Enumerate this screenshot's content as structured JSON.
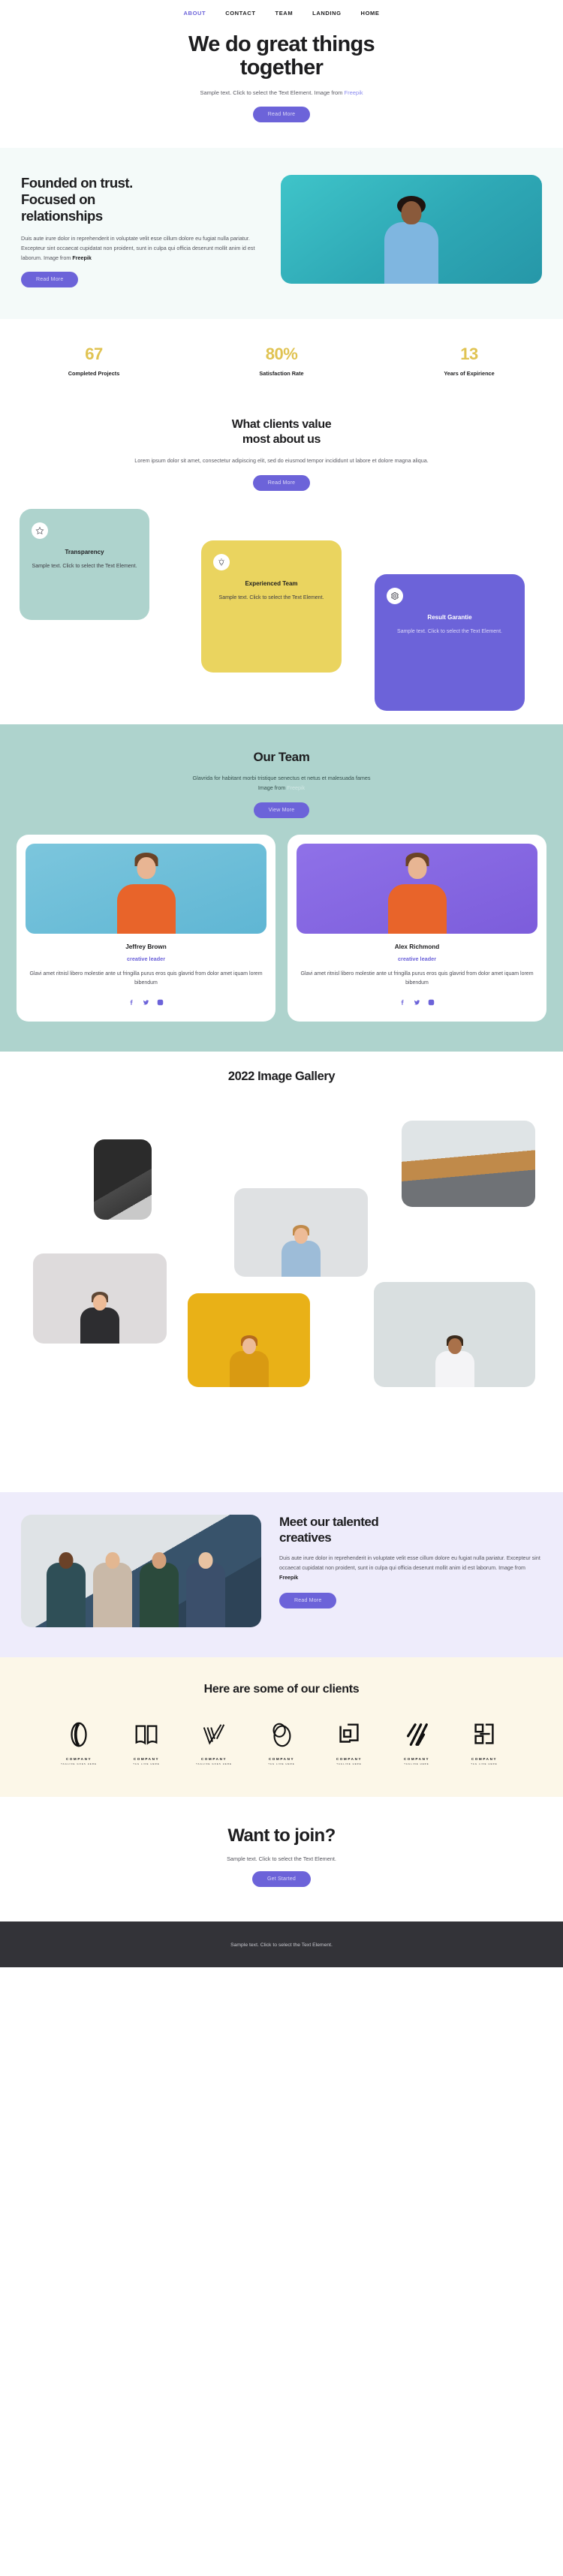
{
  "nav": {
    "items": [
      {
        "label": "ABOUT",
        "active": true
      },
      {
        "label": "CONTACT",
        "active": false
      },
      {
        "label": "TEAM",
        "active": false
      },
      {
        "label": "LANDING",
        "active": false
      },
      {
        "label": "HOME",
        "active": false
      }
    ]
  },
  "hero": {
    "title_line1": "We do great things",
    "title_line2": "together",
    "subtitle": "Sample text. Click to select the Text Element. Image from ",
    "subtitle_link": "Freepik",
    "button": "Read More",
    "highlight_color": "#b4dbd6"
  },
  "founded": {
    "title_line1": "Founded on trust.",
    "title_line2": "Focused on",
    "title_line3": "relationships",
    "body": "Duis aute irure dolor in reprehenderit in voluptate velit esse cillum dolore eu fugiat nulla pariatur. Excepteur sint occaecat cupidatat non proident, sunt in culpa qui officia deserunt mollit anim id est laborum. Image from ",
    "body_strong": "Freepik",
    "button": "Read More",
    "bg_color": "#f4faf9"
  },
  "stats": {
    "items": [
      {
        "value": "67",
        "label": "Completed Projects"
      },
      {
        "value": "80%",
        "label": "Satisfaction Rate"
      },
      {
        "value": "13",
        "label": "Years of Expirience"
      }
    ],
    "value_color": "#e0c352"
  },
  "values": {
    "title_line1": "What clients value",
    "title_line2": "most about us",
    "highlight_color": "#ecd35f",
    "description": "Lorem ipsum dolor sit amet, consectetur adipiscing elit, sed do eiusmod tempor incididunt ut labore et dolore magna aliqua.",
    "button": "Read More",
    "cards": [
      {
        "icon": "star-icon",
        "title": "Transparency",
        "text": "Sample text. Click to select the Text Element.",
        "color": "#aed3cd"
      },
      {
        "icon": "lightbulb-icon",
        "title": "Experienced Team",
        "text": "Sample text. Click to select the Text Element.",
        "color": "#ead45f"
      },
      {
        "icon": "gear-icon",
        "title": "Result Garantie",
        "text": "Sample text. Click to select the Text Element.",
        "color": "#6c63d9"
      }
    ]
  },
  "team": {
    "title": "Our Team",
    "lead_line1": "Glavrida for habitant morbi tristique senectus et netus et malesuada fames",
    "lead_line2": "Image from ",
    "lead_link": "Freepik",
    "button": "View More",
    "bg_color": "#aed3cd",
    "members": [
      {
        "name": "Jeffrey Brown",
        "role": "creative leader",
        "bio": "Glavi amet ritnisl libero molestie ante ut fringilla purus eros quis glavrid from dolor amet iquam lorem bibendum",
        "socials": [
          "facebook-icon",
          "twitter-icon",
          "instagram-icon"
        ]
      },
      {
        "name": "Alex Richmond",
        "role": "creative leader",
        "bio": "Glavi amet ritnisl libero molestie ante ut fringilla purus eros quis glavrid from dolor amet iquam lorem bibendum",
        "socials": [
          "facebook-icon",
          "twitter-icon",
          "instagram-icon"
        ]
      }
    ]
  },
  "gallery": {
    "title": "2022 Image Gallery",
    "highlight_color": "#b4dbd6"
  },
  "meet": {
    "title_line1": "Meet our talented",
    "title_line2": "creatives",
    "body": "Duis aute irure dolor in reprehenderit in voluptate velit esse cillum dolore eu fugiat nulla pariatur. Excepteur sint occaecat cupidatat non proident, sunt in culpa qui officia deserunt mollit anim id est laborum. Image from ",
    "body_strong": "Freepik",
    "button": "Read More",
    "bg_color": "#eeecfb"
  },
  "clients": {
    "title": "Here are some of our clients",
    "bg_color": "#fcf7e8",
    "logos": [
      {
        "name": "COMPANY",
        "tagline": "TAGLINE GOES HERE",
        "mark": "oval-loop-icon"
      },
      {
        "name": "COMPANY",
        "tagline": "TAG LINE HERE",
        "mark": "open-book-icon"
      },
      {
        "name": "COMPANY",
        "tagline": "TAGLINE GOES HERE",
        "mark": "checkmark-lines-icon"
      },
      {
        "name": "COMPANY",
        "tagline": "TAG LINE HERE",
        "mark": "double-oval-icon"
      },
      {
        "name": "COMPANY",
        "tagline": "TAGLINE HERE",
        "mark": "squares-icon"
      },
      {
        "name": "COMPANY",
        "tagline": "TAGLINE HERE",
        "mark": "slanted-bars-icon"
      },
      {
        "name": "COMPANY",
        "tagline": "TAG LINE HERE",
        "mark": "block-letter-icon"
      }
    ]
  },
  "cta": {
    "title": "Want to join?",
    "subtitle": "Sample text. Click to select the Text Element.",
    "button": "Get Started",
    "highlight_color": "#b4dbd6"
  },
  "footer": {
    "text": "Sample text. Click to select the Text Element.",
    "bg_color": "#333338"
  }
}
